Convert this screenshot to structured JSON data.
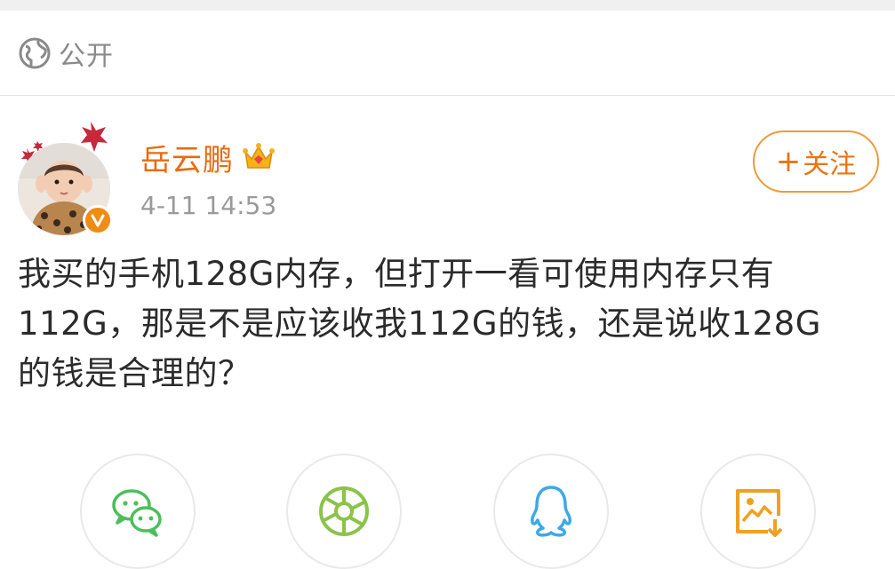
{
  "visibility": {
    "label": "公开",
    "icon": "globe-icon"
  },
  "post": {
    "author": {
      "name": "岳云鹏",
      "badge_icon": "crown-icon",
      "verified_icon": "vip-v-icon"
    },
    "timestamp": "4-11 14:53",
    "follow_button": {
      "label": "关注",
      "icon": "plus-icon"
    },
    "text_lines": [
      "我买的手机128G内存，但打开一看可使用内存只有",
      "112G，那是不是应该收我112G的钱，还是说收128G",
      "的钱是合理的？"
    ]
  },
  "share": {
    "items": [
      {
        "name": "wechat",
        "icon": "wechat-icon",
        "color": "#4cbf5a"
      },
      {
        "name": "moments",
        "icon": "moments-icon",
        "color": "#8bc34a"
      },
      {
        "name": "qq",
        "icon": "qq-icon",
        "color": "#3da9e8"
      },
      {
        "name": "save-image",
        "icon": "save-image-icon",
        "color": "#f0a020"
      }
    ]
  },
  "colors": {
    "accent_orange": "#e86b0f",
    "follow_border": "#ef9a3b",
    "muted_text": "#9a9a9a",
    "body_text": "#2b2b2b"
  }
}
